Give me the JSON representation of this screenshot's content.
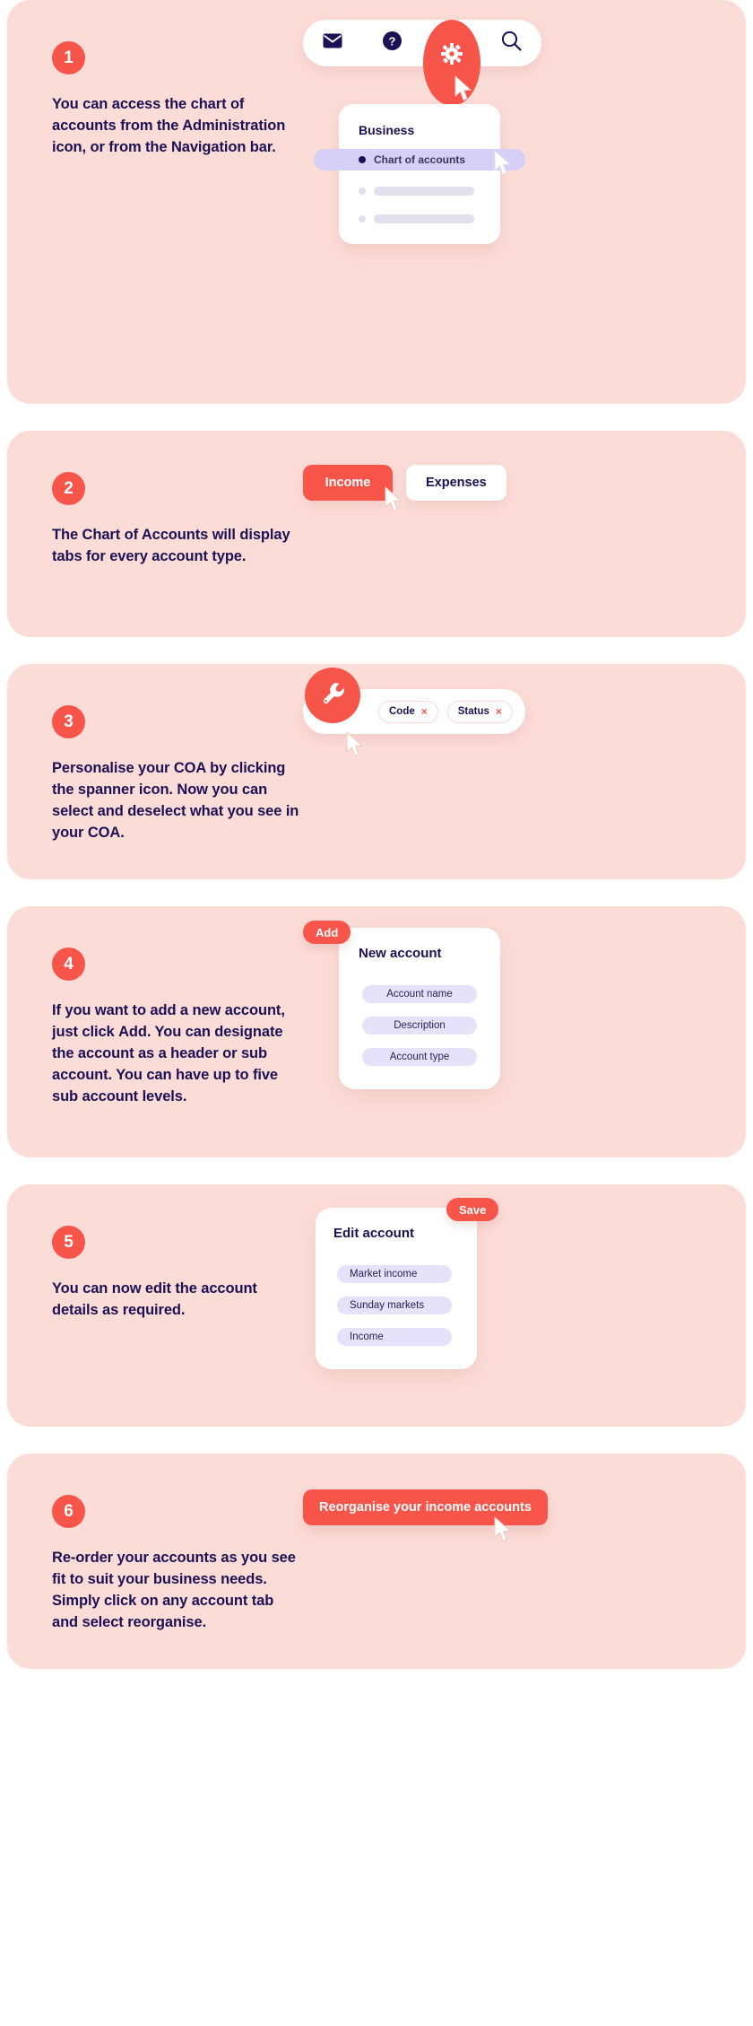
{
  "theme": {
    "panel_bg": "#FCDCD7",
    "accent_red": "#F7554A",
    "navy": "#1B1154",
    "lavender_pill": "#E6E2F9",
    "lavender_highlight": "#D6D0F7",
    "page_bg": "#FFFFFF"
  },
  "steps": [
    {
      "number": "1",
      "text_parts": [
        {
          "t": "You can access the chart of accounts from the Administration icon, or from the Navigation bar.",
          "bold": false
        }
      ],
      "text": "You can access the chart of accounts from the Administration icon, or from the Navigation bar.",
      "visual": {
        "type": "toolbar-and-menu",
        "toolbar_icons": [
          {
            "name": "mail-icon",
            "glyph": "envelope"
          },
          {
            "name": "help-icon",
            "glyph": "question"
          },
          {
            "name": "gear-icon",
            "glyph": "gear"
          },
          {
            "name": "search-icon",
            "glyph": "magnifier"
          }
        ],
        "card_title": "Business",
        "selected_item": "Chart of accounts",
        "placeholder_rows": 2
      }
    },
    {
      "number": "2",
      "text": "The Chart of Accounts will display tabs for every account type.",
      "visual": {
        "type": "tabs",
        "tabs": [
          {
            "label": "Income",
            "active": true
          },
          {
            "label": "Expenses",
            "active": false
          }
        ]
      }
    },
    {
      "number": "3",
      "text": "Personalise your COA by clicking the spanner icon. Now you can select and deselect what you see in your COA.",
      "visual": {
        "type": "chipbar",
        "icon": "wrench-icon",
        "chips": [
          {
            "label": "Code",
            "remove": "×"
          },
          {
            "label": "Status",
            "remove": "×"
          }
        ]
      }
    },
    {
      "number": "4",
      "text_before": "If you want to add a new account, just click ",
      "text_bold": "Add",
      "text_after": ". You can designate the account as a header or sub account. You can have up to five sub account levels.",
      "visual": {
        "type": "form-card",
        "button_label": "Add",
        "button_position": "top-left",
        "title": "New account",
        "fields": [
          "Account name",
          "Description",
          "Account type"
        ],
        "field_align": "center"
      }
    },
    {
      "number": "5",
      "text": "You can now edit the account details as required.",
      "visual": {
        "type": "form-card",
        "button_label": "Save",
        "button_position": "top-right",
        "title": "Edit account",
        "fields": [
          "Market income",
          "Sunday markets",
          "Income"
        ],
        "field_align": "left"
      }
    },
    {
      "number": "6",
      "text_before": "Re-order your accounts as you see fit to suit your business needs. Simply click on any account tab and select ",
      "text_bold": "reorganise",
      "text_after": ".",
      "visual": {
        "type": "button",
        "label": "Reorganise your income accounts"
      }
    }
  ]
}
